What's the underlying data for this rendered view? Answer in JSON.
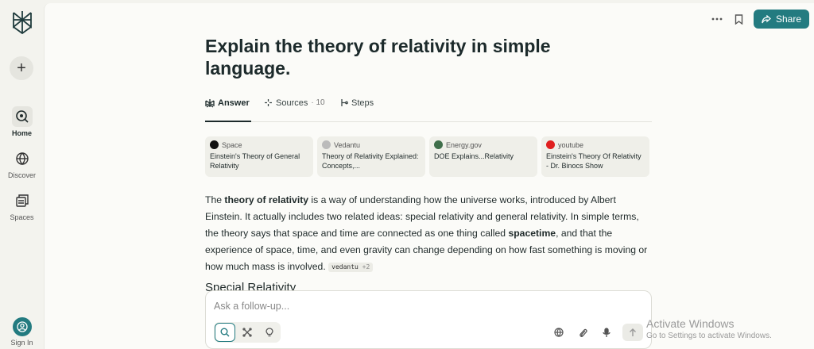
{
  "sidebar": {
    "new_label": "+",
    "items": [
      {
        "label": "Home",
        "icon": "home-search-icon"
      },
      {
        "label": "Discover",
        "icon": "globe-icon"
      },
      {
        "label": "Spaces",
        "icon": "spaces-icon"
      }
    ],
    "sign_in_label": "Sign In"
  },
  "header": {
    "share_label": "Share"
  },
  "thread": {
    "title": "Explain the theory of relativity in simple language.",
    "tabs": [
      {
        "label": "Answer"
      },
      {
        "label": "Sources",
        "count": "· 10"
      },
      {
        "label": "Steps"
      }
    ]
  },
  "sources": [
    {
      "site": "Space",
      "title": "Einstein's Theory of General Relativity",
      "favicon_color": "#111111"
    },
    {
      "site": "Vedantu",
      "title": "Theory of Relativity Explained: Concepts,...",
      "favicon_color": "#bbbbbb"
    },
    {
      "site": "Energy.gov",
      "title": "DOE Explains...Relativity",
      "favicon_color": "#3f6e4a"
    },
    {
      "site": "youtube",
      "title": "Einstein's Theory Of Relativity - Dr. Binocs Show",
      "favicon_color": "#e02020"
    }
  ],
  "answer": {
    "p1": "The ",
    "b1": "theory of relativity",
    "p2": " is a way of understanding how the universe works, introduced by Albert Einstein. It actually includes two related ideas: special relativity and general relativity. In simple terms, the theory says that space and time are connected as one thing called ",
    "b2": "spacetime",
    "p3": ", and that the experience of space, time, and even gravity can change depending on how fast something is moving or how much mass is involved. ",
    "citation_source": "vedantu",
    "citation_more": "+2",
    "subheading": "Special Relativity"
  },
  "composer": {
    "placeholder": "Ask a follow-up..."
  },
  "watermark": {
    "line1": "Activate Windows",
    "line2": "Go to Settings to activate Windows."
  },
  "colors": {
    "accent": "#237b80",
    "background": "#f3f3ee",
    "panel": "#fbfbf8"
  }
}
